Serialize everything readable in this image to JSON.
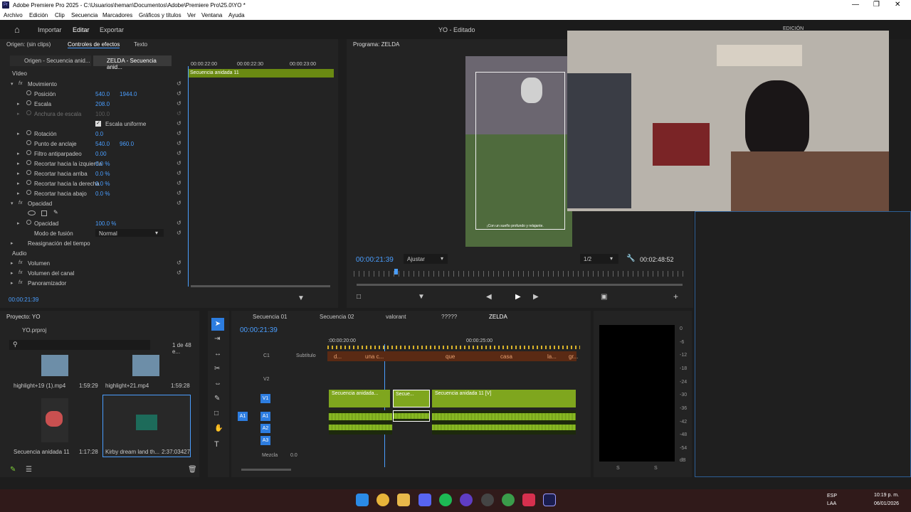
{
  "window": {
    "title": "Adobe Premiere Pro 2025 - C:\\Usuarios\\heman\\Documentos\\Adobe\\Premiere Pro\\25.0\\YO *"
  },
  "menu": [
    "Archivo",
    "Edición",
    "Clip",
    "Secuencia",
    "Marcadores",
    "Gráficos y títulos",
    "Ver",
    "Ventana",
    "Ayuda"
  ],
  "workspace": {
    "import": "Importar",
    "edit": "Editar",
    "export": "Exportar",
    "project_title": "YO - Editado",
    "right_label": "EDICIÓN"
  },
  "source_panel": {
    "tabs": [
      "Origen: (sin clips)",
      "Controles de efectos",
      "Texto"
    ],
    "subtabs": [
      "Origen - Secuencia anid...",
      "ZELDA - Secuencia anid..."
    ],
    "ruler": [
      "00:00:22:00",
      "00:00:22:30",
      "00:00:23:00"
    ],
    "clip_label": "Secuencia anidada 11",
    "video_header": "Vídeo",
    "audio_header": "Audio",
    "rows": {
      "movimiento": "Movimiento",
      "posicion": "Posición",
      "posicion_x": "540.0",
      "posicion_y": "1944.0",
      "escala": "Escala",
      "escala_v": "208.0",
      "anchura": "Anchura de escala",
      "anchura_v": "100.0",
      "uniforme": "Escala uniforme",
      "rotacion": "Rotación",
      "rotacion_v": "0.0",
      "anclaje": "Punto de anclaje",
      "anclaje_x": "540.0",
      "anclaje_y": "960.0",
      "filtro": "Filtro antiparpadeo",
      "filtro_v": "0.00",
      "rec_izq": "Recortar hacia la izquierda",
      "rec_izq_v": "0.0 %",
      "rec_arr": "Recortar hacia arriba",
      "rec_arr_v": "0.0 %",
      "rec_der": "Recortar hacia la derecha",
      "rec_der_v": "0.0 %",
      "rec_aba": "Recortar hacia abajo",
      "rec_aba_v": "0.0 %",
      "opacidad_h": "Opacidad",
      "opacidad": "Opacidad",
      "opacidad_v": "100.0 %",
      "fusion": "Modo de fusión",
      "fusion_v": "Normal",
      "reasig": "Reasignación del tiempo",
      "volumen": "Volumen",
      "vol_canal": "Volumen del canal",
      "panor": "Panoramizador"
    },
    "timecode": "00:00:21:39"
  },
  "program_panel": {
    "title": "Programa: ZELDA",
    "timecode": "00:00:21:39",
    "fit": "Ajustar",
    "resolution": "1/2",
    "duration": "00:02:48:52",
    "caption": "¡Con un sueño profundo y relajante."
  },
  "project_panel": {
    "title": "Proyecto: YO",
    "file": "YO.prproj",
    "count": "1 de 48 e...",
    "items": [
      {
        "name": "highlight+19 (1).mp4",
        "dur": "1:59:29"
      },
      {
        "name": "highlight+21.mp4",
        "dur": "1:59:28"
      },
      {
        "name": "Secuencia anidada 11",
        "dur": "1:17:28"
      },
      {
        "name": "Kirby dream land th...",
        "dur": "2:37:03427"
      }
    ]
  },
  "timeline": {
    "tabs": [
      "Secuencia 01",
      "Secuencia 02",
      "valorant",
      "?????",
      "ZELDA"
    ],
    "timecode": "00:00:21:39",
    "ruler": [
      ":00:00:20:00",
      "00:00:25:00"
    ],
    "subtitle_label": "Subtítulo",
    "subtitle_clips": [
      "d...",
      "una c...",
      "que",
      "casa",
      "la...",
      "gr..."
    ],
    "tracks": {
      "c1": "C1",
      "v2": "V2",
      "v1": "V1",
      "a1": "A1",
      "a2": "A2",
      "a3": "A3",
      "mix": "Mezcla",
      "mix_v": "0.0"
    },
    "clips": [
      "Secuencia anidada...",
      "Secue...",
      "Secuencia anidada 11 [V]"
    ]
  },
  "meter": {
    "labels": [
      "0",
      "-6",
      "-12",
      "-18",
      "-24",
      "-30",
      "-36",
      "-42",
      "-48",
      "-54",
      "dB"
    ],
    "bottom": [
      "S",
      "S"
    ]
  },
  "taskbar": {
    "lang1": "ESP",
    "lang2": "LAA",
    "time": "10:19 p. m.",
    "date": "06/01/2026"
  }
}
